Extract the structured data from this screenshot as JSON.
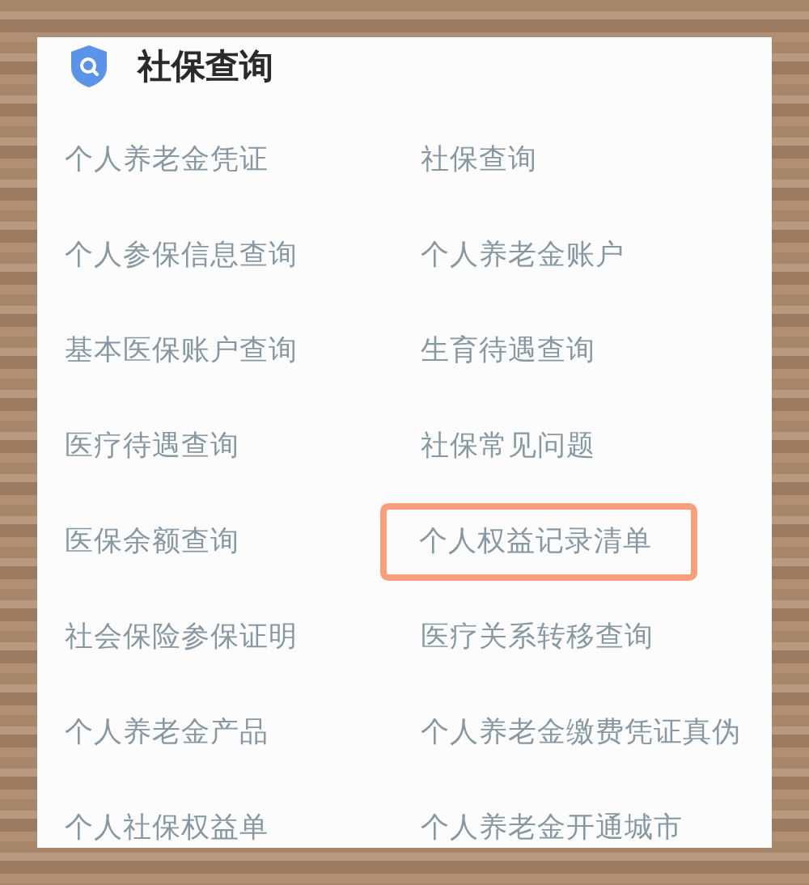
{
  "header": {
    "title": "社保查询"
  },
  "items": [
    {
      "label": "个人养老金凭证",
      "highlighted": false
    },
    {
      "label": "社保查询",
      "highlighted": false
    },
    {
      "label": "个人参保信息查询",
      "highlighted": false
    },
    {
      "label": "个人养老金账户",
      "highlighted": false
    },
    {
      "label": "基本医保账户查询",
      "highlighted": false
    },
    {
      "label": "生育待遇查询",
      "highlighted": false
    },
    {
      "label": "医疗待遇查询",
      "highlighted": false
    },
    {
      "label": "社保常见问题",
      "highlighted": false
    },
    {
      "label": "医保余额查询",
      "highlighted": false
    },
    {
      "label": "个人权益记录清单",
      "highlighted": true
    },
    {
      "label": "社会保险参保证明",
      "highlighted": false
    },
    {
      "label": "医疗关系转移查询",
      "highlighted": false
    },
    {
      "label": "个人养老金产品",
      "highlighted": false
    },
    {
      "label": "个人养老金缴费凭证真伪",
      "highlighted": false
    },
    {
      "label": "个人社保权益单",
      "highlighted": false
    },
    {
      "label": "个人养老金开通城市",
      "highlighted": false
    }
  ]
}
